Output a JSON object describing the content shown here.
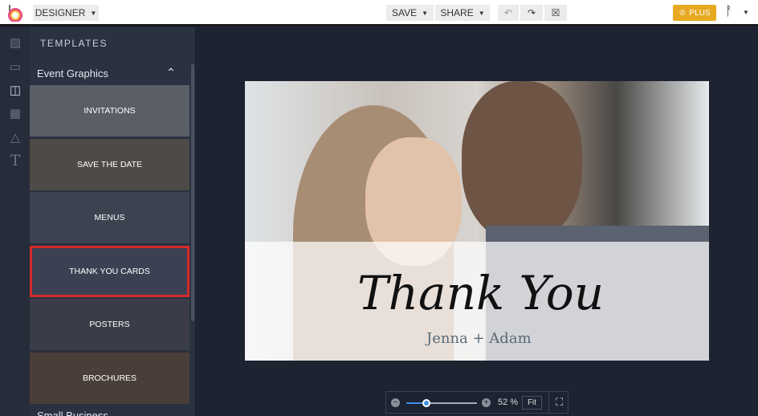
{
  "topbar": {
    "mode": "DESIGNER",
    "save": "SAVE",
    "share": "SHARE",
    "plus": "PLUS",
    "undo_icon": "↶",
    "redo_icon": "↷",
    "close_icon": "☒"
  },
  "panel": {
    "title": "TEMPLATES",
    "section": "Event Graphics",
    "next_section": "Small Business",
    "tiles": [
      {
        "label": "INVITATIONS",
        "color": "#5a5e66"
      },
      {
        "label": "SAVE THE DATE",
        "color": "#4d4a48"
      },
      {
        "label": "MENUS",
        "color": "#3b4350"
      },
      {
        "label": "THANK YOU CARDS",
        "color": "#3b4152"
      },
      {
        "label": "POSTERS",
        "color": "#3a3d47"
      },
      {
        "label": "BROCHURES",
        "color": "#4a3f38"
      }
    ]
  },
  "card": {
    "title": "Thank You",
    "names": "Jenna + Adam"
  },
  "zoom": {
    "percent": "52 %",
    "fit": "Fit",
    "level": 0.28
  }
}
